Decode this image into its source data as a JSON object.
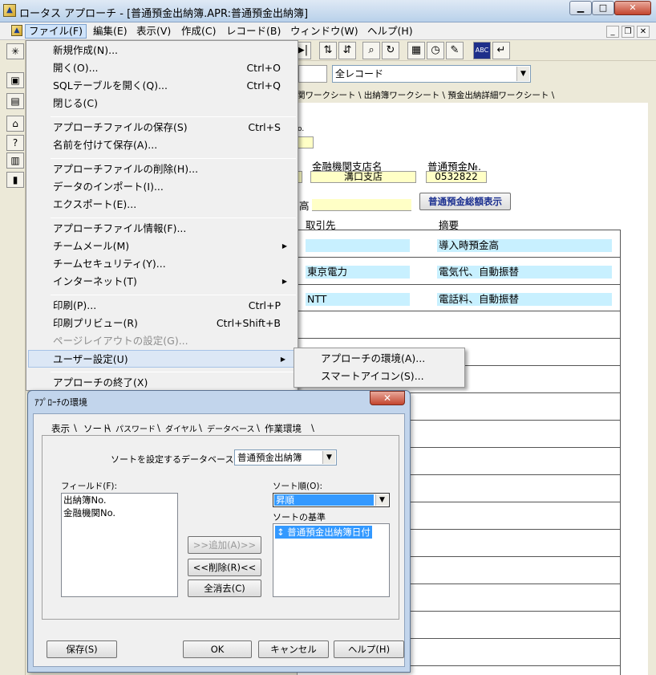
{
  "window": {
    "title": "ロータス アプローチ - [普通預金出納簿.APR:普通預金出納簿]"
  },
  "menubar": [
    "ファイル(F)",
    "編集(E)",
    "表示(V)",
    "作成(C)",
    "レコード(B)",
    "ウィンドウ(W)",
    "ヘルプ(H)"
  ],
  "record_filter": "全レコード",
  "worksheet_tabs": "関ワークシート \\ 出納簿ワークシート \\ 預金出納詳細ワークシート \\",
  "form": {
    "no_fragment": "o.",
    "label_branch": "金融機関支店名",
    "label_account": "普通預金№.",
    "branch_value": "溝口支店",
    "account_value": "0532822",
    "balance_fragment": "高",
    "balance_button": "普通預金総額表示",
    "col_partner": "取引先",
    "col_summary": "摘要",
    "rows": [
      {
        "partner": "",
        "summary": "導入時預金高"
      },
      {
        "partner": "東京電力",
        "summary": "電気代、自動振替"
      },
      {
        "partner": "NTT",
        "summary": "電話料、自動振替"
      }
    ]
  },
  "file_menu": {
    "items": [
      {
        "label": "新規作成(N)...",
        "shortcut": ""
      },
      {
        "label": "開く(O)...",
        "shortcut": "Ctrl+O"
      },
      {
        "label": "SQLテーブルを開く(Q)...",
        "shortcut": "Ctrl+Q"
      },
      {
        "label": "閉じる(C)",
        "shortcut": ""
      },
      {
        "label": "アプローチファイルの保存(S)",
        "shortcut": "Ctrl+S"
      },
      {
        "label": "名前を付けて保存(A)...",
        "shortcut": ""
      },
      {
        "label": "アプローチファイルの削除(H)...",
        "shortcut": ""
      },
      {
        "label": "データのインポート(I)...",
        "shortcut": ""
      },
      {
        "label": "エクスポート(E)...",
        "shortcut": ""
      },
      {
        "label": "アプローチファイル情報(F)...",
        "shortcut": ""
      },
      {
        "label": "チームメール(M)",
        "shortcut": ""
      },
      {
        "label": "チームセキュリティ(Y)...",
        "shortcut": ""
      },
      {
        "label": "インターネット(T)",
        "shortcut": ""
      },
      {
        "label": "印刷(P)...",
        "shortcut": "Ctrl+P"
      },
      {
        "label": "印刷プリビュー(R)",
        "shortcut": "Ctrl+Shift+B"
      },
      {
        "label": "ページレイアウトの設定(G)...",
        "shortcut": ""
      },
      {
        "label": "ユーザー設定(U)",
        "shortcut": ""
      },
      {
        "label": "アプローチの終了(X)",
        "shortcut": ""
      }
    ]
  },
  "submenu": {
    "items": [
      "アプローチの環境(A)...",
      "スマートアイコン(S)..."
    ]
  },
  "dialog": {
    "title": "ｱﾌﾟﾛｰﾁの環境",
    "tabs": [
      "表示",
      "ソート",
      "パスワード",
      "ダイヤル",
      "データベース",
      "作業環境"
    ],
    "db_label": "ソートを設定するデータベース(M):",
    "db_value": "普通預金出納簿",
    "fields_label": "フィールド(F):",
    "fields": [
      "出納簿No.",
      "金融機関No."
    ],
    "sort_order_label": "ソート順(O):",
    "sort_order_value": "昇順",
    "sort_basis_label": "ソートの基準",
    "sort_basis": [
      "普通預金出納簿日付"
    ],
    "btn_add": ">>追加(A)>>",
    "btn_remove": "<<削除(R)<<",
    "btn_clear": "全消去(C)",
    "btn_save": "保存(S)",
    "btn_ok": "OK",
    "btn_cancel": "キャンセル",
    "btn_help": "ヘルプ(H)"
  }
}
